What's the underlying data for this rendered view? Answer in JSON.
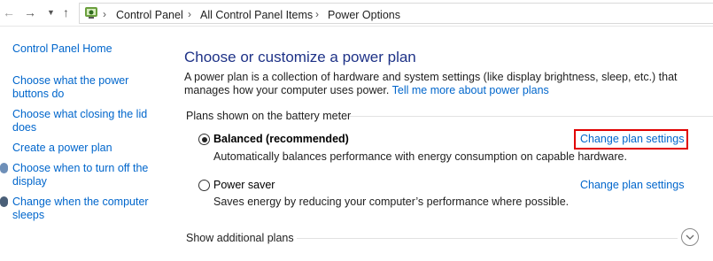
{
  "address": {
    "crumbs": [
      "Control Panel",
      "All Control Panel Items",
      "Power Options"
    ],
    "back_icon": "arrow-left-icon",
    "forward_icon": "arrow-right-icon",
    "recent_icon": "chevron-down-icon",
    "up_icon": "arrow-up-icon",
    "location_icon": "power-options-icon"
  },
  "sidebar": {
    "home": "Control Panel Home",
    "links": [
      "Choose what the power buttons do",
      "Choose what closing the lid does",
      "Create a power plan",
      "Choose when to turn off the display",
      "Change when the computer sleeps"
    ]
  },
  "main": {
    "heading": "Choose or customize a power plan",
    "description": "A power plan is a collection of hardware and system settings (like display brightness, sleep, etc.) that manages how your computer uses power.",
    "tell_more": "Tell me more about power plans",
    "group_label": "Plans shown on the battery meter",
    "plans": [
      {
        "name": "Balanced (recommended)",
        "description": "Automatically balances performance with energy consumption on capable hardware.",
        "change": "Change plan settings",
        "selected": true
      },
      {
        "name": "Power saver",
        "description": "Saves energy by reducing your computer’s performance where possible.",
        "change": "Change plan settings",
        "selected": false
      }
    ],
    "show_additional": "Show additional plans"
  },
  "colors": {
    "link": "#0066cc",
    "heading": "#1e3287",
    "highlight": "#e10000"
  }
}
